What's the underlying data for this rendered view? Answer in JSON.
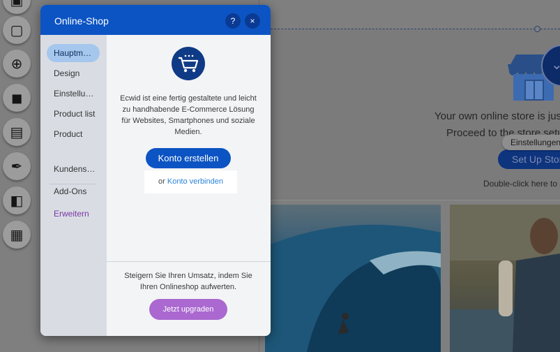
{
  "rail": {
    "tools": [
      {
        "name": "frame-tool-icon",
        "glyph": "▣"
      },
      {
        "name": "strip-tool-icon",
        "glyph": "▢"
      },
      {
        "name": "add-tool-icon",
        "glyph": "⊕"
      },
      {
        "name": "apps-tool-icon",
        "glyph": "◼"
      },
      {
        "name": "media-tool-icon",
        "glyph": "▤"
      },
      {
        "name": "pen-tool-icon",
        "glyph": "✒"
      },
      {
        "name": "bag-tool-icon",
        "glyph": "◧"
      },
      {
        "name": "bookings-tool-icon",
        "glyph": "▦"
      }
    ]
  },
  "dialog": {
    "title": "Online-Shop",
    "help_label": "?",
    "close_label": "×",
    "nav": [
      {
        "label": "Hauptm…",
        "active": true
      },
      {
        "label": "Design"
      },
      {
        "label": "Einstellu…"
      },
      {
        "label": "Product list"
      },
      {
        "label": "Product"
      },
      {
        "label": "Kundens…"
      },
      {
        "label": "Add-Ons"
      },
      {
        "label": "Erweitern",
        "color": "#7b35a6"
      }
    ],
    "description": "Ecwid ist eine fertig gestaltete und leicht zu handhabende E-Commerce Lösung für Websites, Smartphones und soziale Medien.",
    "create_account_label": "Konto erstellen",
    "connect_prefix": "or",
    "connect_link": "Konto verbinden",
    "upsell_text": "Steigern Sie Ihren Umsatz, indem Sie Ihren Onlineshop aufwerten.",
    "upgrade_label": "Jetzt upgraden"
  },
  "canvas": {
    "store_line1": "Your own online store is just",
    "store_line2": "Proceed to the store setu",
    "tooltip": "Einstellungen",
    "setup_button": "Set Up Store",
    "double_click": "Double-click here to g"
  },
  "colors": {
    "dialog_header": "#0c54c3",
    "primary_button": "#0c54c3",
    "upgrade_button": "#aa68d0",
    "link": "#2b84d8"
  }
}
